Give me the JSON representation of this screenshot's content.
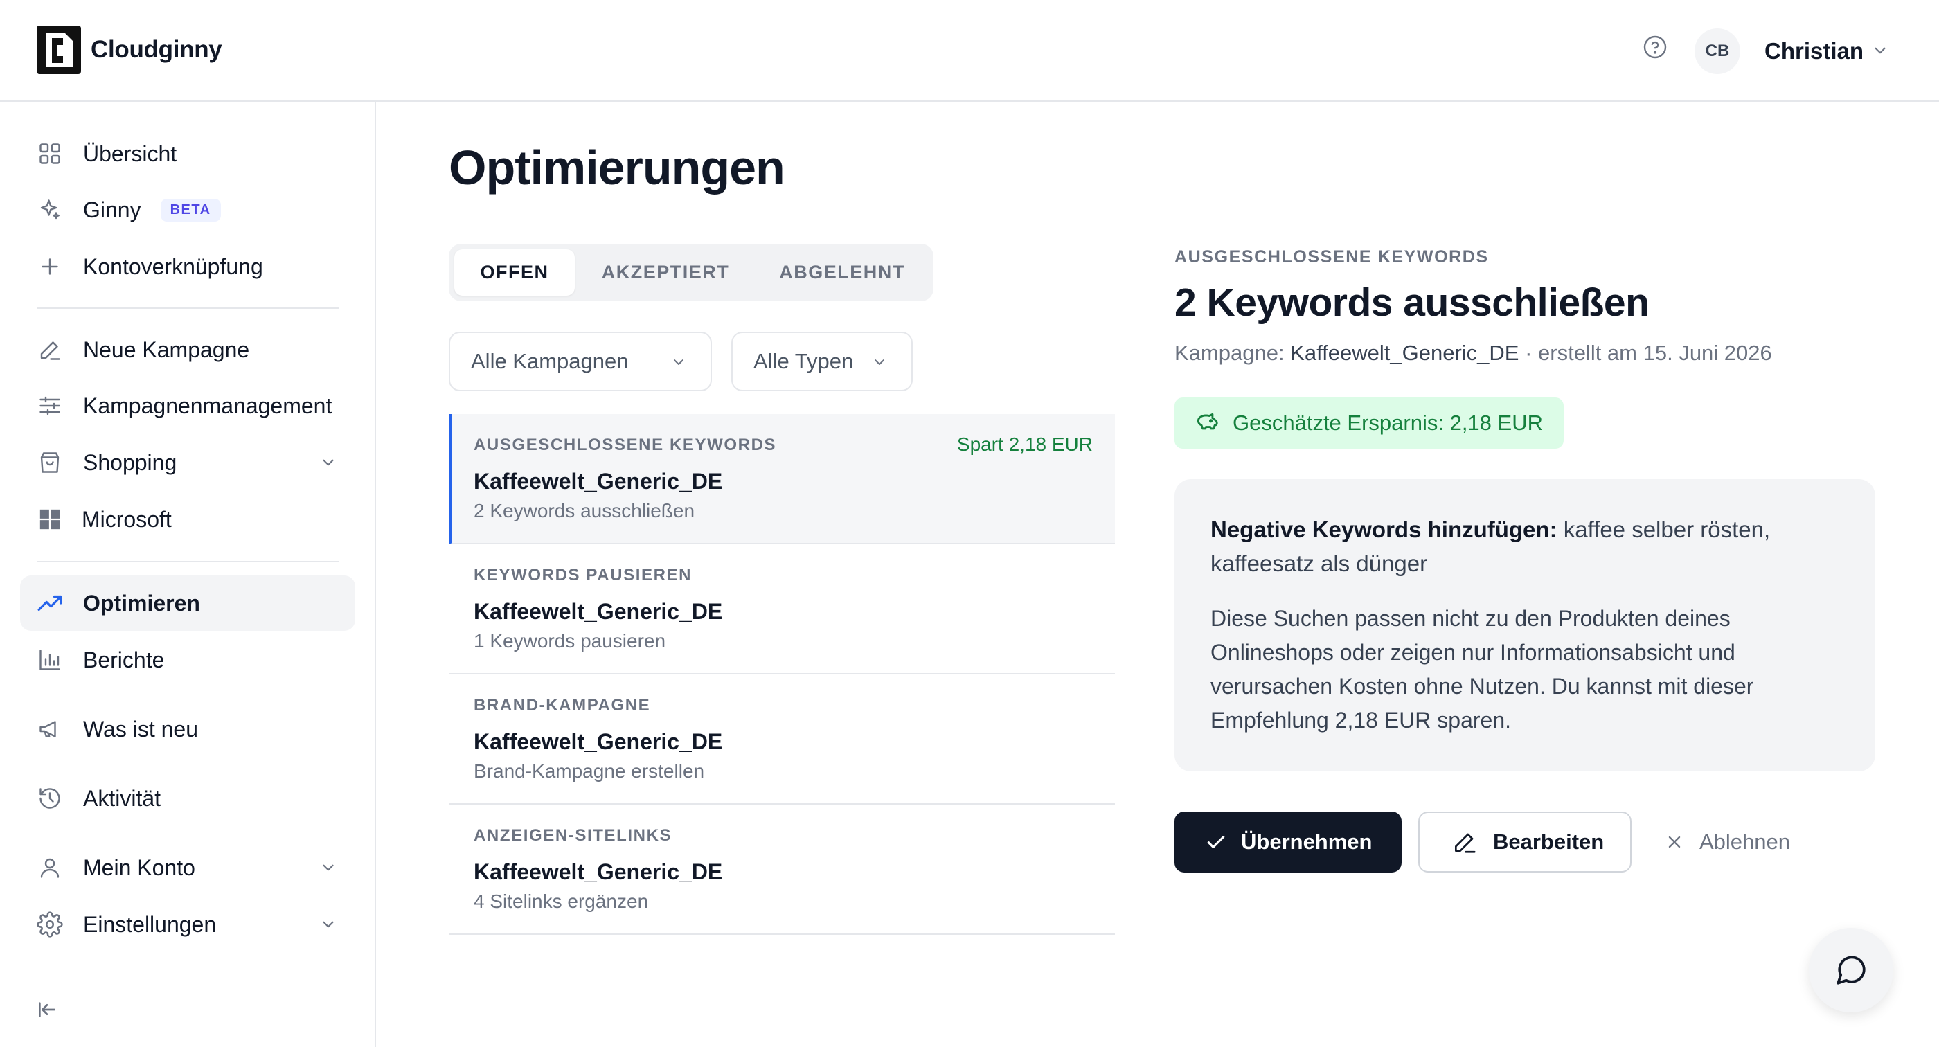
{
  "app": {
    "name": "Cloudginny"
  },
  "header": {
    "avatar_initials": "CB",
    "user_name": "Christian"
  },
  "sidebar": {
    "items": [
      {
        "label": "Übersicht"
      },
      {
        "label": "Ginny",
        "badge": "BETA"
      },
      {
        "label": "Kontoverknüpfung"
      },
      {
        "label": "Neue Kampagne"
      },
      {
        "label": "Kampagnenmanagement"
      },
      {
        "label": "Shopping"
      },
      {
        "label": "Microsoft"
      },
      {
        "label": "Optimieren",
        "active": true
      },
      {
        "label": "Berichte"
      },
      {
        "label": "Was ist neu"
      },
      {
        "label": "Aktivität"
      },
      {
        "label": "Mein Konto"
      },
      {
        "label": "Einstellungen"
      }
    ]
  },
  "main": {
    "title": "Optimierungen",
    "tabs": [
      {
        "label": "OFFEN",
        "active": true
      },
      {
        "label": "AKZEPTIERT"
      },
      {
        "label": "ABGELEHNT"
      }
    ],
    "filters": {
      "campaign": "Alle Kampagnen",
      "type": "Alle Typen"
    },
    "list": [
      {
        "type": "AUSGESCHLOSSENE KEYWORDS",
        "savings": "Spart 2,18 EUR",
        "title": "Kaffeewelt_Generic_DE",
        "subtitle": "2 Keywords ausschließen"
      },
      {
        "type": "KEYWORDS PAUSIEREN",
        "title": "Kaffeewelt_Generic_DE",
        "subtitle": "1 Keywords pausieren"
      },
      {
        "type": "BRAND-KAMPAGNE",
        "title": "Kaffeewelt_Generic_DE",
        "subtitle": "Brand-Kampagne erstellen"
      },
      {
        "type": "ANZEIGEN-SITELINKS",
        "title": "Kaffeewelt_Generic_DE",
        "subtitle": "4 Sitelinks ergänzen"
      }
    ]
  },
  "detail": {
    "type": "AUSGESCHLOSSENE KEYWORDS",
    "title": "2 Keywords ausschließen",
    "meta_prefix": "Kampagne: ",
    "campaign": "Kaffeewelt_Generic_DE",
    "meta_suffix": " · erstellt am 15. Juni 2026",
    "savings": "Geschätzte Ersparnis: 2,18 EUR",
    "card_lead": "Negative Keywords hinzufügen:",
    "card_keywords": " kaffee selber rösten, kaffeesatz als dünger",
    "card_text": "Diese Suchen passen nicht zu den Produkten deines Onlineshops oder zeigen nur Informationsabsicht und verursachen Kosten ohne Nutzen. Du kannst mit dieser Empfehlung 2,18 EUR sparen.",
    "buttons": {
      "accept": "Übernehmen",
      "edit": "Bearbeiten",
      "reject": "Ablehnen"
    }
  },
  "colors": {
    "accent_dark": "#111827",
    "active_border": "#2563eb",
    "savings_green": "#15803d",
    "savings_bg": "#dcfce7",
    "beta_blue": "#4f46e5"
  }
}
